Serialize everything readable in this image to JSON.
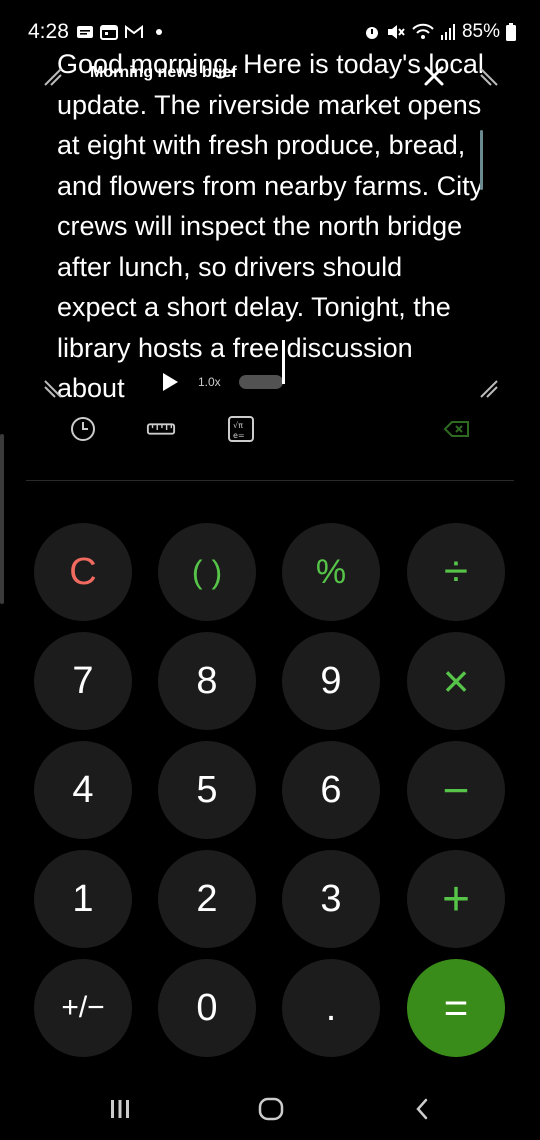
{
  "status_bar": {
    "time": "4:28",
    "battery": "85%"
  },
  "caption": {
    "title": "Morning news brief",
    "text": "Good morning. Here is today's local update. The riverside market opens at eight with fresh produce, bread, and flowers from nearby farms. City crews will inspect the north bridge after lunch, so drivers should expect a short delay. Tonight, the library hosts a free discussion about",
    "speed": "1.0x"
  },
  "keys": {
    "clear": "C",
    "parens": "( )",
    "percent": "%",
    "divide": "÷",
    "seven": "7",
    "eight": "8",
    "nine": "9",
    "multiply": "×",
    "four": "4",
    "five": "5",
    "six": "6",
    "minus": "−",
    "one": "1",
    "two": "2",
    "three": "3",
    "plus": "+",
    "negate": "+/−",
    "zero": "0",
    "decimal": ".",
    "equals": "="
  },
  "colors": {
    "accent_green": "#56c448",
    "clear_red": "#f06a60",
    "equals_bg": "#3a8c1a",
    "key_bg": "#1c1c1c"
  },
  "icons": {
    "tools": [
      "history-icon",
      "ruler-icon",
      "scientific-icon",
      "backspace-icon"
    ],
    "nav": [
      "recent-apps-icon",
      "home-icon",
      "back-icon"
    ]
  }
}
